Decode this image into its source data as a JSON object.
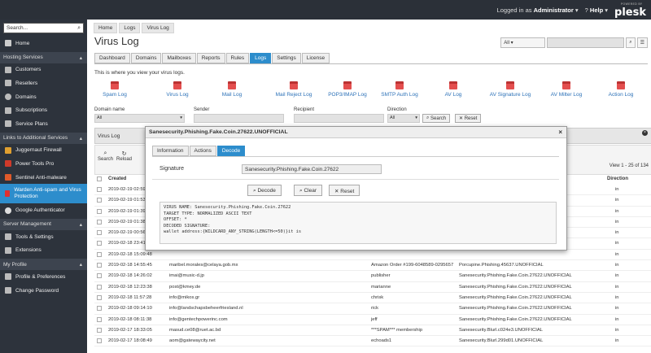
{
  "topbar": {
    "logged_in": "Logged in as",
    "user": "Administrator",
    "help": "Help",
    "brand_small": "POWERED BY",
    "brand": "plesk"
  },
  "sidebar": {
    "search_placeholder": "Search...",
    "home": "Home",
    "sec_hosting": "Hosting Services",
    "customers": "Customers",
    "resellers": "Resellers",
    "domains": "Domains",
    "subscriptions": "Subscriptions",
    "service_plans": "Service Plans",
    "sec_links": "Links to Additional Services",
    "juggernaut": "Juggernaut Firewall",
    "powertools": "Power Tools Pro",
    "sentinel": "Sentinel Anti-malware",
    "warden": "Warden Anti-spam and Virus Protection",
    "google": "Google Authenticator",
    "sec_server": "Server Management",
    "tools": "Tools & Settings",
    "extensions": "Extensions",
    "sec_profile": "My Profile",
    "profile": "Profile & Preferences",
    "change_password": "Change Password"
  },
  "breadcrumbs": [
    "Home",
    "Logs",
    "Virus Log"
  ],
  "page_title": "Virus Log",
  "top_filter": {
    "select": "All",
    "search_icon": "search-icon"
  },
  "tabs": [
    "Dashboard",
    "Domains",
    "Mailboxes",
    "Reports",
    "Rules",
    "Logs",
    "Settings",
    "License"
  ],
  "intro": "This is where you view your virus logs.",
  "log_links": [
    "Spam Log",
    "Virus Log",
    "Mail Log",
    "Mail Reject Log",
    "POP3/IMAP Log",
    "SMTP Auth Log",
    "AV Log",
    "AV Signature Log",
    "AV Milter Log",
    "Action Log"
  ],
  "filters": {
    "domain_label": "Domain name",
    "domain_value": "All",
    "sender_label": "Sender",
    "recipient_label": "Recipient",
    "direction_label": "Direction",
    "direction_value": "All",
    "search": "Search",
    "reset": "Reset"
  },
  "grid": {
    "title": "Virus Log",
    "search": "Search",
    "reload": "Reload",
    "view": "View 1 - 25 of 134",
    "col_created": "Created",
    "col_direction": "Direction"
  },
  "rows": [
    {
      "date": "2019-02-19 02:59:05",
      "from": "",
      "to": "",
      "subject": "",
      "virus": "",
      "dir": "in"
    },
    {
      "date": "2019-02-19 01:53:34",
      "from": "",
      "to": "",
      "subject": "",
      "virus": "",
      "dir": "in"
    },
    {
      "date": "2019-02-19 01:39:28",
      "from": "",
      "to": "",
      "subject": "",
      "virus": "",
      "dir": "in"
    },
    {
      "date": "2019-02-19 01:38:30",
      "from": "",
      "to": "",
      "subject": "",
      "virus": "",
      "dir": "in"
    },
    {
      "date": "2019-02-19 00:56:12",
      "from": "",
      "to": "",
      "subject": "",
      "virus": "",
      "dir": "in"
    },
    {
      "date": "2019-02-18 23:41:46",
      "from": "",
      "to": "",
      "subject": "",
      "virus": "",
      "dir": "in"
    },
    {
      "date": "2019-02-18 15:09:48",
      "from": "",
      "to": "",
      "subject": "",
      "virus": "",
      "dir": "in"
    },
    {
      "date": "2019-02-18 14:55:45",
      "from": "maribel.morales@celaya.gob.mx",
      "to": "",
      "subject": "Amazon Order #199-6048589-0295657",
      "virus": "Porcupine.Phishing.45637.UNOFFICIAL",
      "dir": "in"
    },
    {
      "date": "2019-02-18 14:26:02",
      "from": "imai@music-d.jp",
      "to": "",
      "subject": "publisher",
      "virus": "Sanesecurity.Phishing.Fake.Coin.27622.UNOFFICIAL",
      "dir": "in"
    },
    {
      "date": "2019-02-18 12:23:38",
      "from": "post@kmey.de",
      "to": "",
      "subject": "marianne",
      "virus": "Sanesecurity.Phishing.Fake.Coin.27622.UNOFFICIAL",
      "dir": "in"
    },
    {
      "date": "2019-02-18 11:57:28",
      "from": "info@mikos.gr",
      "to": "",
      "subject": "chrisk",
      "virus": "Sanesecurity.Phishing.Fake.Coin.27622.UNOFFICIAL",
      "dir": "in"
    },
    {
      "date": "2019-02-18 09:14:10",
      "from": "info@landschapsbeheerfriesland.nl",
      "to": "",
      "subject": "rick",
      "virus": "Sanesecurity.Phishing.Fake.Coin.27622.UNOFFICIAL",
      "dir": "in"
    },
    {
      "date": "2019-02-18 08:11:38",
      "from": "info@gentechpowerinc.com",
      "to": "",
      "subject": "jeff",
      "virus": "Sanesecurity.Phishing.Fake.Coin.27622.UNOFFICIAL",
      "dir": "in"
    },
    {
      "date": "2019-02-17 18:33:05",
      "from": "masud.ce08@ruet.ac.bd",
      "to": "",
      "subject": "***SPAM*** membership",
      "virus": "Sanesecurity.Blurl.c024e3.UNOFFICIAL",
      "dir": "in"
    },
    {
      "date": "2019-02-17 18:08:49",
      "from": "aom@gatewaycity.net",
      "to": "",
      "subject": "echoads1",
      "virus": "Sanesecurity.Blurl.299d01.UNOFFICIAL",
      "dir": "in"
    }
  ],
  "modal": {
    "title": "Sanesecurity.Phishing.Fake.Coin.27622.UNOFFICIAL",
    "tabs": [
      "Information",
      "Actions",
      "Decode"
    ],
    "sig_label": "Signature",
    "sig_value": "Sanesecurity.Phishing.Fake.Coin.27622",
    "decode": "Decode",
    "clear": "Clear",
    "reset": "Reset",
    "result": "VIRUS NAME: Sanesecurity.Phishing.Fake.Coin.27622\nTARGET TYPE: NORMALIZED ASCII TEXT\nOFFSET: *\nDECODED SIGNATURE:\nwallet address:{WILDCARD_ANY_STRING(LENGTH<=50)}it is"
  }
}
